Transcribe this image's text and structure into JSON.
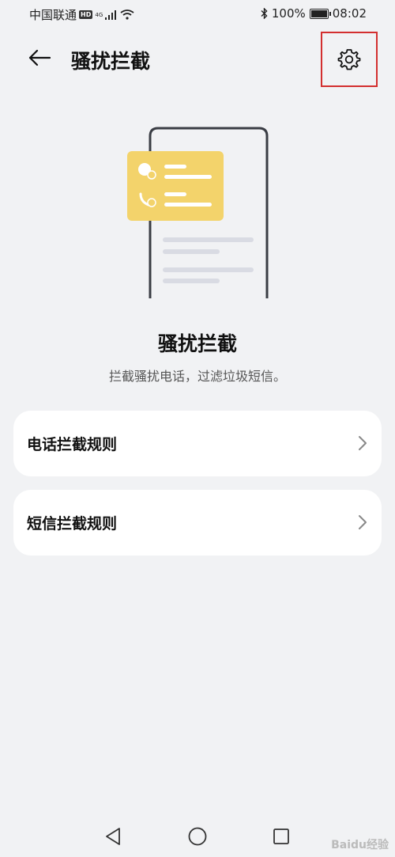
{
  "status_bar": {
    "carrier": "中国联通",
    "hd_badge": "HD",
    "signal_label": "4G",
    "battery": "100%",
    "time": "08:02"
  },
  "header": {
    "title": "骚扰拦截"
  },
  "hero": {
    "title": "骚扰拦截",
    "subtitle": "拦截骚扰电话，过滤垃圾短信。"
  },
  "rules": [
    {
      "label": "电话拦截规则"
    },
    {
      "label": "短信拦截规则"
    }
  ],
  "watermark": "Baidu经验",
  "colors": {
    "background": "#f1f2f4",
    "card": "#ffffff",
    "illustration_yellow": "#f3d36b",
    "highlight_box": "#d32f2f"
  },
  "icons": [
    "back-arrow-icon",
    "settings-gear-icon",
    "chevron-right-icon",
    "nav-back-icon",
    "nav-home-icon",
    "nav-recents-icon"
  ]
}
